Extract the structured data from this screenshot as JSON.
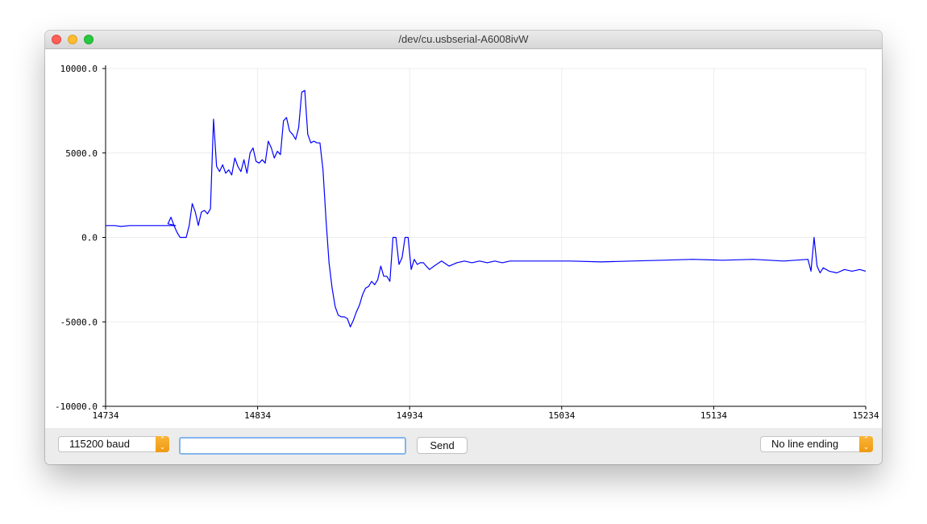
{
  "window": {
    "title": "/dev/cu.usbserial-A6008ivW"
  },
  "toolbar": {
    "baud_value": "115200 baud",
    "message_value": "",
    "send_label": "Send",
    "line_ending_value": "No line ending"
  },
  "icons": {
    "select_arrow": "updown-chevron-icon"
  },
  "colors": {
    "series": "#0000ff",
    "accent": "#f5a623",
    "focus": "#84b5ec"
  },
  "chart_data": {
    "type": "line",
    "grid": true,
    "xlim": [
      14734,
      15234
    ],
    "ylim": [
      -10000,
      10000
    ],
    "x_ticks": [
      "14734",
      "14834",
      "14934",
      "15034",
      "15134",
      "15234"
    ],
    "y_ticks": [
      "10000.0",
      "5000.0",
      "0.0",
      "-5000.0",
      "-10000.0"
    ],
    "series": [
      {
        "x": [
          14734,
          14740,
          14744,
          14750,
          14760,
          14770,
          14780,
          14775,
          14777,
          14779,
          14781,
          14783,
          14785,
          14787,
          14789,
          14791,
          14793,
          14795,
          14797,
          14799,
          14801,
          14803,
          14805,
          14807,
          14809,
          14811,
          14813,
          14815,
          14817,
          14819,
          14821,
          14823,
          14825,
          14827,
          14829,
          14831,
          14833,
          14835,
          14837,
          14839,
          14841,
          14843,
          14845,
          14847,
          14849,
          14851,
          14853,
          14855,
          14857,
          14859,
          14861,
          14863,
          14865,
          14867,
          14869,
          14871,
          14873,
          14875,
          14877,
          14879,
          14881,
          14883,
          14885,
          14887,
          14889,
          14891,
          14893,
          14895,
          14897,
          14899,
          14901,
          14903,
          14905,
          14907,
          14909,
          14911,
          14913,
          14915,
          14917,
          14919,
          14921,
          14923,
          14925,
          14927,
          14929,
          14931,
          14933,
          14935,
          14937,
          14939,
          14941,
          14943,
          14945,
          14947,
          14950,
          14955,
          14960,
          14965,
          14970,
          14975,
          14980,
          14985,
          14990,
          14995,
          15000,
          15020,
          15040,
          15060,
          15080,
          15100,
          15120,
          15140,
          15160,
          15180,
          15196,
          15198,
          15200,
          15202,
          15204,
          15206,
          15210,
          15215,
          15220,
          15225,
          15230,
          15234
        ],
        "y": [
          700,
          700,
          650,
          700,
          700,
          700,
          700,
          800,
          1200,
          700,
          300,
          0,
          0,
          0,
          700,
          2000,
          1500,
          700,
          1500,
          1600,
          1400,
          1700,
          7000,
          4200,
          3900,
          4300,
          3800,
          4000,
          3700,
          4700,
          4200,
          3900,
          4600,
          3800,
          5000,
          5300,
          4500,
          4400,
          4600,
          4400,
          5700,
          5300,
          4700,
          5100,
          4900,
          6900,
          7100,
          6300,
          6100,
          5800,
          6500,
          8600,
          8700,
          6100,
          5600,
          5700,
          5600,
          5600,
          4000,
          1000,
          -1500,
          -3000,
          -4100,
          -4600,
          -4700,
          -4700,
          -4800,
          -5300,
          -4900,
          -4400,
          -4000,
          -3400,
          -3000,
          -2900,
          -2600,
          -2800,
          -2500,
          -1700,
          -2300,
          -2300,
          -2600,
          0,
          0,
          -1600,
          -1200,
          0,
          0,
          -1900,
          -1300,
          -1600,
          -1500,
          -1500,
          -1700,
          -1900,
          -1700,
          -1400,
          -1700,
          -1500,
          -1400,
          -1500,
          -1400,
          -1500,
          -1400,
          -1500,
          -1400,
          -1400,
          -1400,
          -1450,
          -1400,
          -1350,
          -1300,
          -1350,
          -1300,
          -1400,
          -1300,
          -2000,
          0,
          -1700,
          -2100,
          -1800,
          -2000,
          -2100,
          -1900,
          -2000,
          -1900,
          -2000
        ]
      }
    ]
  }
}
